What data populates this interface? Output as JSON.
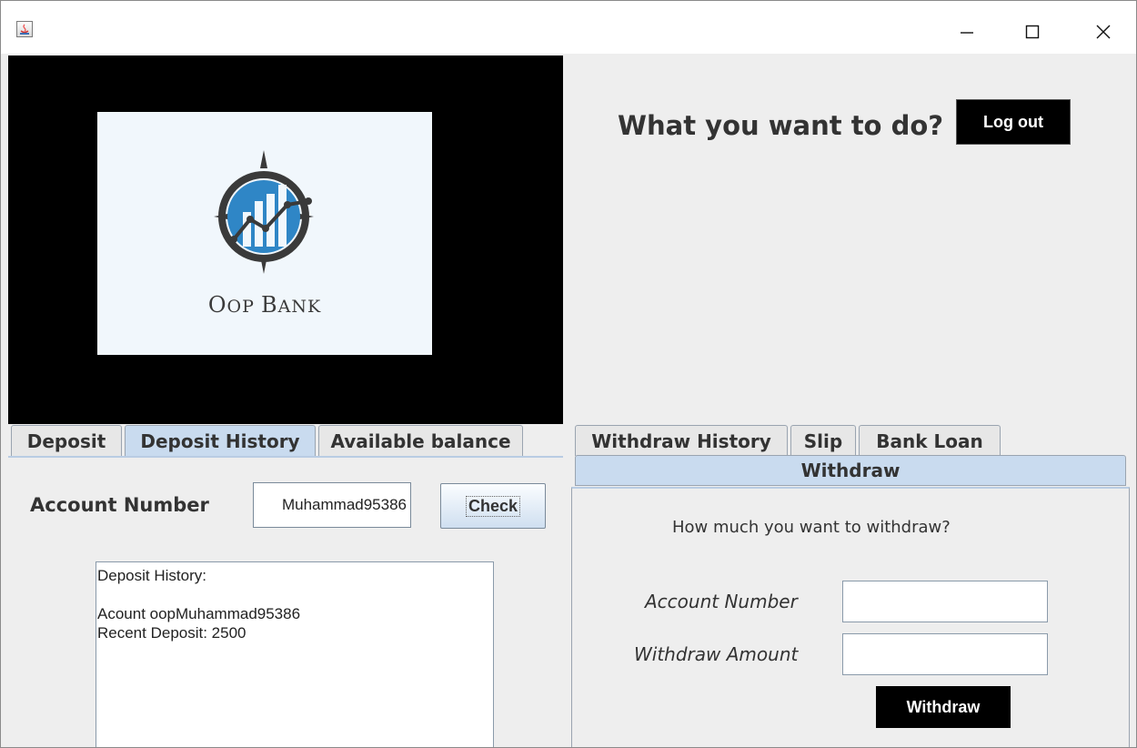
{
  "window": {
    "minimize_glyph": "—",
    "maximize_glyph": "☐",
    "close_glyph": "✕"
  },
  "logo": {
    "text_big1": "O",
    "text_small1": "OP ",
    "text_big2": "B",
    "text_small2": "ANK",
    "colors": {
      "ring": "#3a3a3a",
      "blue": "#2f86c6",
      "card": "#f1f7fc"
    }
  },
  "left_tabs": [
    {
      "label": "Deposit",
      "active": false
    },
    {
      "label": "Deposit History",
      "active": true
    },
    {
      "label": "Available balance",
      "active": false
    }
  ],
  "deposit_history": {
    "account_label": "Account Number",
    "account_value": "Muhammad95386",
    "check_label": "Check",
    "history_lines": [
      "Deposit History:",
      "",
      "Acount oopMuhammad95386",
      "Recent Deposit: 2500"
    ]
  },
  "right": {
    "question": "What you want to do?",
    "logout_label": "Log out",
    "tabs": [
      {
        "label": "Withdraw History"
      },
      {
        "label": "Slip"
      },
      {
        "label": "Bank Loan"
      }
    ],
    "withdraw_tab": "Withdraw",
    "withdraw_question": "How much you want to withdraw?",
    "account_label": "Account Number",
    "account_value": "",
    "amount_label": "Withdraw Amount",
    "amount_value": "",
    "withdraw_button": "Withdraw"
  }
}
